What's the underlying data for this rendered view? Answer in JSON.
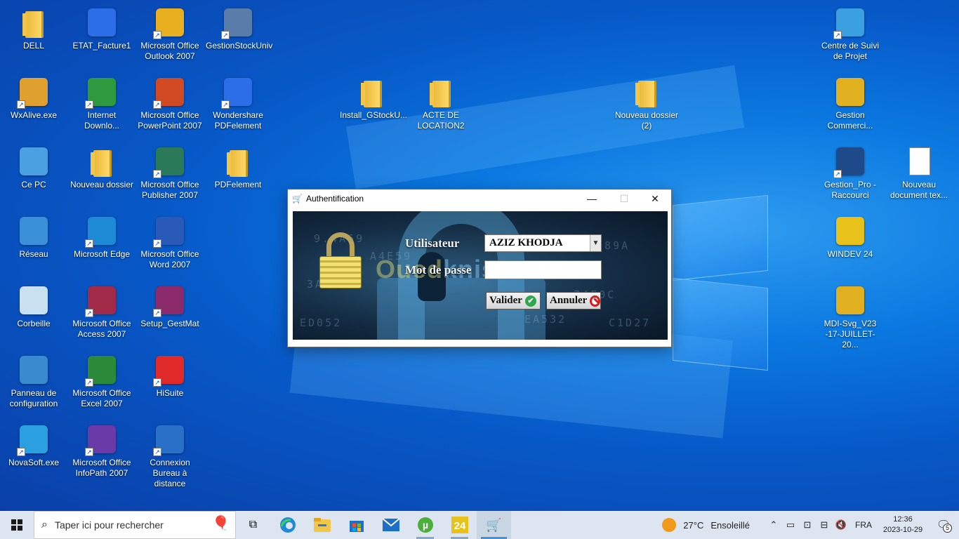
{
  "desktop": {
    "icons": [
      {
        "label": "DELL",
        "icon": "user-folder-icon"
      },
      {
        "label": "ETAT_Facture1",
        "icon": "pdfelement-icon"
      },
      {
        "label": "Microsoft Office Outlook 2007",
        "icon": "outlook-icon"
      },
      {
        "label": "GestionStockUniv",
        "icon": "user-shortcut-icon"
      },
      {
        "label": "Centre de Suivi de Projet",
        "icon": "people-icon"
      },
      {
        "label": "WxAlive.exe",
        "icon": "wxalive-icon"
      },
      {
        "label": "Internet Downlo...",
        "icon": "idm-icon"
      },
      {
        "label": "Microsoft Office PowerPoint 2007",
        "icon": "powerpoint-icon"
      },
      {
        "label": "Wondershare PDFelement",
        "icon": "pdfelement-icon"
      },
      {
        "label": "Install_GStockU...",
        "icon": "folder-icon"
      },
      {
        "label": "ACTE DE LOCATION2",
        "icon": "folder-icon"
      },
      {
        "label": "Nouveau dossier (2)",
        "icon": "folder-icon"
      },
      {
        "label": "Gestion Commerci...",
        "icon": "windev-folder-icon"
      },
      {
        "label": "Ce PC",
        "icon": "computer-icon"
      },
      {
        "label": "Nouveau dossier",
        "icon": "folder-icon"
      },
      {
        "label": "Microsoft Office Publisher 2007",
        "icon": "publisher-icon"
      },
      {
        "label": "PDFelement",
        "icon": "folder-icon"
      },
      {
        "label": "Gestion_Pro - Raccourci",
        "icon": "cart-icon"
      },
      {
        "label": "Nouveau document tex...",
        "icon": "text-document-icon"
      },
      {
        "label": "Réseau",
        "icon": "network-icon"
      },
      {
        "label": "Microsoft Edge",
        "icon": "edge-icon"
      },
      {
        "label": "Microsoft Office Word 2007",
        "icon": "word-icon"
      },
      {
        "label": "WINDEV 24",
        "icon": "windev-icon"
      },
      {
        "label": "Corbeille",
        "icon": "recycle-bin-icon"
      },
      {
        "label": "Microsoft Office Access 2007",
        "icon": "access-icon"
      },
      {
        "label": "Setup_GestMat",
        "icon": "winrar-icon"
      },
      {
        "label": "MDI-Svg_V23 -17-JUILLET-20...",
        "icon": "windev-folder-icon"
      },
      {
        "label": "Panneau de configuration",
        "icon": "control-panel-icon"
      },
      {
        "label": "Microsoft Office Excel 2007",
        "icon": "excel-icon"
      },
      {
        "label": "HiSuite",
        "icon": "hisuite-icon"
      },
      {
        "label": "NovaSoft.exe",
        "icon": "info-icon"
      },
      {
        "label": "Microsoft Office InfoPath 2007",
        "icon": "infopath-icon"
      },
      {
        "label": "Connexion Bureau à distance",
        "icon": "remote-desktop-icon"
      }
    ]
  },
  "dialog": {
    "title": "Authentification",
    "title_icon": "cart-icon",
    "minimize": "—",
    "maximize": "☐",
    "close": "✕",
    "user_label": "Utilisateur",
    "user_value": "AZIZ KHODJA",
    "password_label": "Mot de passe",
    "password_value": "",
    "validate_label": "Valider",
    "cancel_label": "Annuler",
    "watermark_a": "Oued",
    "watermark_b": "kniss.com",
    "bg_code": [
      "9.4A69",
      "A4E59",
      "5889A",
      "ED052",
      "EA532",
      "74F0C",
      "3A9E8",
      "C1D27"
    ]
  },
  "taskbar": {
    "search_placeholder": "Taper ici pour rechercher",
    "weather_temp": "27°C",
    "weather_text": "Ensoleillé",
    "language": "FRA",
    "time": "12:36",
    "date": "2023-10-29",
    "notification_count": "5",
    "apps": [
      "task-view-icon",
      "edge-icon",
      "file-explorer-icon",
      "store-icon",
      "mail-icon",
      "utorrent-icon",
      "windev-icon",
      "cart-icon"
    ]
  },
  "colors": {
    "wallpaper": "#0a78e0",
    "taskbar": "#dde6f0",
    "accent": "#4a90d9"
  }
}
